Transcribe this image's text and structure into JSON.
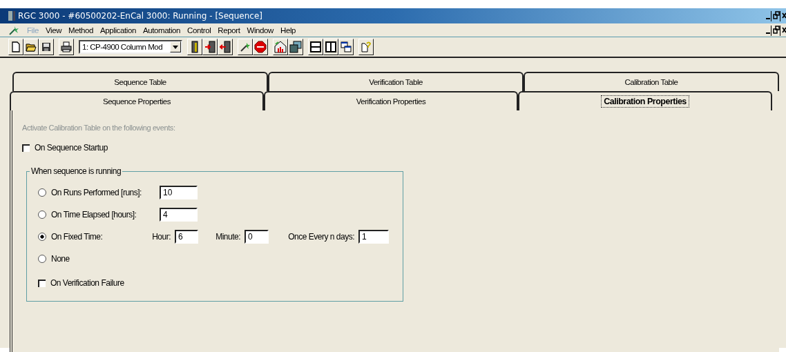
{
  "window": {
    "title": "RGC 3000  - #60500202-EnCal 3000: Running - [Sequence]"
  },
  "menu": [
    {
      "label": "File",
      "disabled": true
    },
    {
      "label": "View",
      "disabled": false
    },
    {
      "label": "Method",
      "disabled": false
    },
    {
      "label": "Application",
      "disabled": false
    },
    {
      "label": "Automation",
      "disabled": false
    },
    {
      "label": "Control",
      "disabled": false
    },
    {
      "label": "Report",
      "disabled": false
    },
    {
      "label": "Window",
      "disabled": false
    },
    {
      "label": "Help",
      "disabled": false
    }
  ],
  "toolbar": {
    "method_dropdown": {
      "value": "1: CP-4900 Column Mod"
    }
  },
  "tab_rows": [
    {
      "tabs": [
        {
          "label": "Sequence Table",
          "selected": false
        },
        {
          "label": "Verification Table",
          "selected": false
        },
        {
          "label": "Calibration Table",
          "selected": false
        }
      ]
    },
    {
      "tabs": [
        {
          "label": "Sequence Properties",
          "selected": false
        },
        {
          "label": "Verification Properties",
          "selected": false
        },
        {
          "label": "Calibration Properties",
          "selected": true
        }
      ]
    }
  ],
  "panel": {
    "instruction": "Activate Calibration Table on the following events:",
    "startup_checkbox": {
      "label": "On Sequence Startup",
      "checked": false
    },
    "group": {
      "legend": "When sequence is running",
      "options": [
        {
          "kind": "single",
          "label": "On Runs Performed [runs]:",
          "selected": false,
          "value": "10"
        },
        {
          "kind": "single",
          "label": "On Time Elapsed [hours]:",
          "selected": false,
          "value": "4"
        },
        {
          "kind": "multi",
          "label": "On Fixed Time:",
          "selected": true,
          "fields": [
            {
              "label": "Hour:",
              "value": "6"
            },
            {
              "label": "Minute:",
              "value": "0"
            },
            {
              "label": "Once Every n days:",
              "value": "1"
            }
          ]
        },
        {
          "kind": "plain",
          "label": "None",
          "selected": false
        }
      ],
      "verification_checkbox": {
        "label": "On Verification Failure",
        "checked": false
      }
    }
  }
}
